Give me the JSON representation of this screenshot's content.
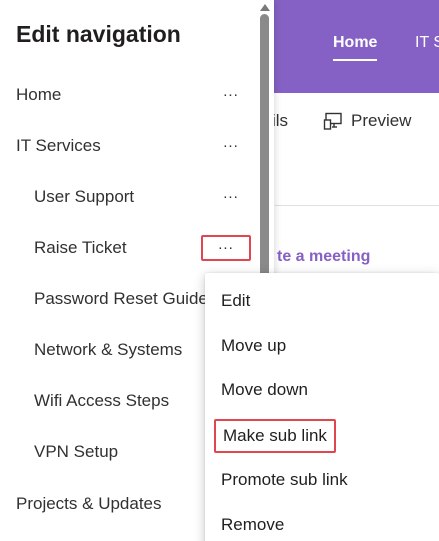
{
  "background": {
    "tabs": {
      "home": "Home",
      "it": "IT S"
    },
    "commands": {
      "details_fragment": "ils",
      "preview": "Preview"
    },
    "meeting_fragment": "te a meeting",
    "sliver_char": "w"
  },
  "nav": {
    "title": "Edit navigation",
    "more_glyph": "...",
    "items": [
      {
        "label": "Home",
        "level": "top",
        "more": true
      },
      {
        "label": "IT Services",
        "level": "top",
        "more": true
      },
      {
        "label": "User Support",
        "level": "sub",
        "more": true
      },
      {
        "label": "Raise Ticket",
        "level": "sub",
        "more": true,
        "highlighted": true
      },
      {
        "label": "Password Reset Guide",
        "level": "sub",
        "more": false
      },
      {
        "label": "Network & Systems",
        "level": "sub",
        "more": false
      },
      {
        "label": "Wifi Access Steps",
        "level": "sub",
        "more": false
      },
      {
        "label": "VPN Setup",
        "level": "sub",
        "more": false
      },
      {
        "label": "Projects & Updates",
        "level": "top",
        "more": false
      }
    ]
  },
  "context_menu": {
    "items": [
      {
        "label": "Edit"
      },
      {
        "label": "Move up"
      },
      {
        "label": "Move down"
      },
      {
        "label": "Make sub link",
        "highlighted": true
      },
      {
        "label": "Promote sub link"
      },
      {
        "label": "Remove"
      }
    ]
  },
  "colors": {
    "header_purple": "#8661c5",
    "highlight_red": "#e0464d",
    "text": "#323130"
  },
  "icons": {
    "preview": "preview-icon",
    "more": "more-options-icon",
    "scroll_up": "scroll-up-arrow-icon"
  }
}
